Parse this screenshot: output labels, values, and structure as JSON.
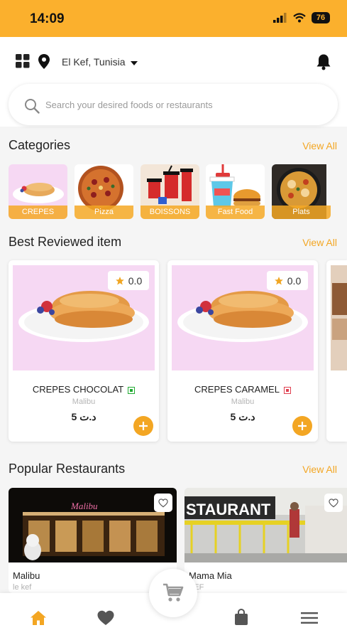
{
  "status_bar": {
    "time": "14:09",
    "battery": "76"
  },
  "header": {
    "location": "El Kef, Tunisia",
    "search_placeholder": "Search your desired foods or restaurants"
  },
  "categories": {
    "title": "Categories",
    "view_all": "View All",
    "items": [
      {
        "label": "CREPES"
      },
      {
        "label": "Pizza"
      },
      {
        "label": "BOISSONS"
      },
      {
        "label": "Fast Food"
      },
      {
        "label": "Plats"
      }
    ]
  },
  "best_reviewed": {
    "title": "Best Reviewed item",
    "view_all": "View All",
    "items": [
      {
        "name": "CREPES CHOCOLAT",
        "restaurant": "Malibu",
        "price": "5 د.ت",
        "rating": "0.0"
      },
      {
        "name": "CREPES CARAMEL",
        "restaurant": "Malibu",
        "price": "5 د.ت",
        "rating": "0.0"
      }
    ]
  },
  "popular_restaurants": {
    "title": "Popular Restaurants",
    "view_all": "View All",
    "items": [
      {
        "name": "Malibu",
        "city": "le kef"
      },
      {
        "name": "Mama Mia",
        "city": "KEF"
      }
    ]
  },
  "colors": {
    "accent": "#fbb02d",
    "accent_text": "#f3a623",
    "background": "#f5f5f5"
  },
  "icons": {
    "header": [
      "grid-icon",
      "location-pin-icon",
      "caret-down-icon",
      "bell-icon",
      "search-icon"
    ],
    "bottom_nav": [
      "home-icon",
      "heart-icon",
      "cart-icon",
      "bag-icon",
      "menu-icon"
    ]
  }
}
